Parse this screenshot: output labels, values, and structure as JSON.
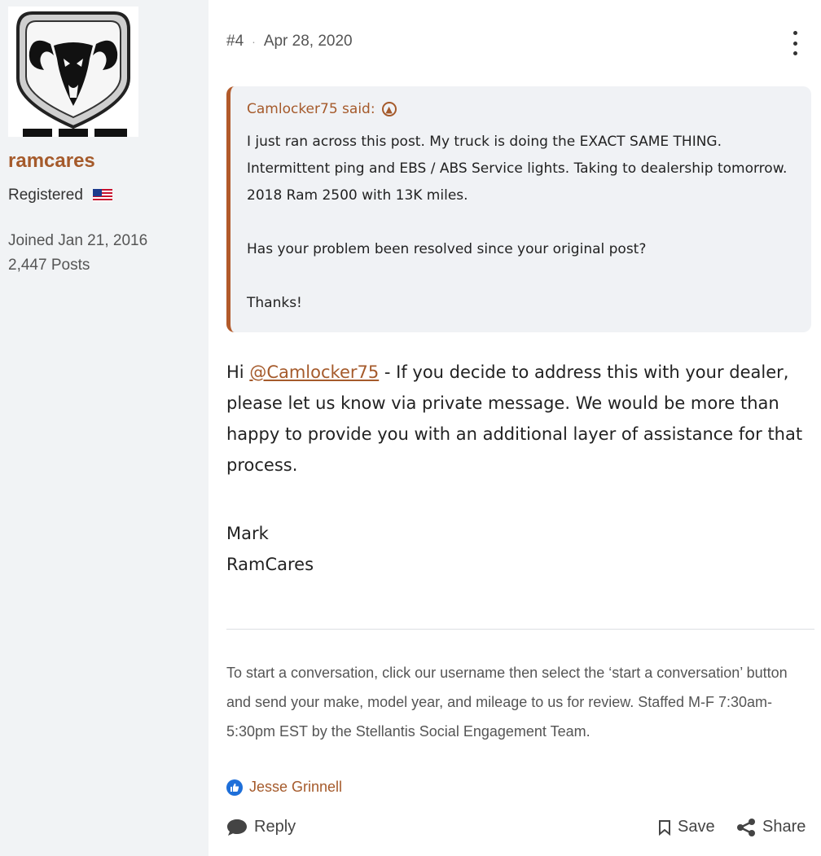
{
  "author": {
    "avatar_text": "RAM",
    "username": "ramcares",
    "role": "Registered",
    "joined": "Joined Jan 21, 2016",
    "posts": "2,447 Posts"
  },
  "post": {
    "number": "#4",
    "separator": "·",
    "date": "Apr 28, 2020",
    "quote": {
      "author_said": "Camlocker75 said:",
      "paragraphs": [
        "I just ran across this post. My truck is doing the EXACT SAME THING. Intermittent ping and EBS / ABS Service lights. Taking to dealership tomorrow. 2018 Ram 2500 with 13K miles.",
        "Has your problem been resolved since your original post?",
        "Thanks!"
      ]
    },
    "body": {
      "greeting": "Hi ",
      "mention": "@Camlocker75",
      "text": " - If you decide to address this with your dealer, please let us know via private message. We would be more than happy to provide you with an additional layer of assistance for that process."
    },
    "signature": [
      "Mark",
      "RamCares"
    ],
    "footer_note": "To start a conversation, click our username then select the ‘start a conversation’ button and send your make, model year, and mileage to us for review. Staffed M-F 7:30am-5:30pm EST by the Stellantis Social Engagement Team.",
    "reactions": {
      "user": "Jesse Grinnell"
    },
    "actions": {
      "reply": "Reply",
      "save": "Save",
      "share": "Share"
    }
  },
  "colors": {
    "accent": "#a55a2b",
    "quote_border": "#b25a2a",
    "like": "#1e6fd9",
    "sidebar_bg": "#f1f3f5"
  }
}
